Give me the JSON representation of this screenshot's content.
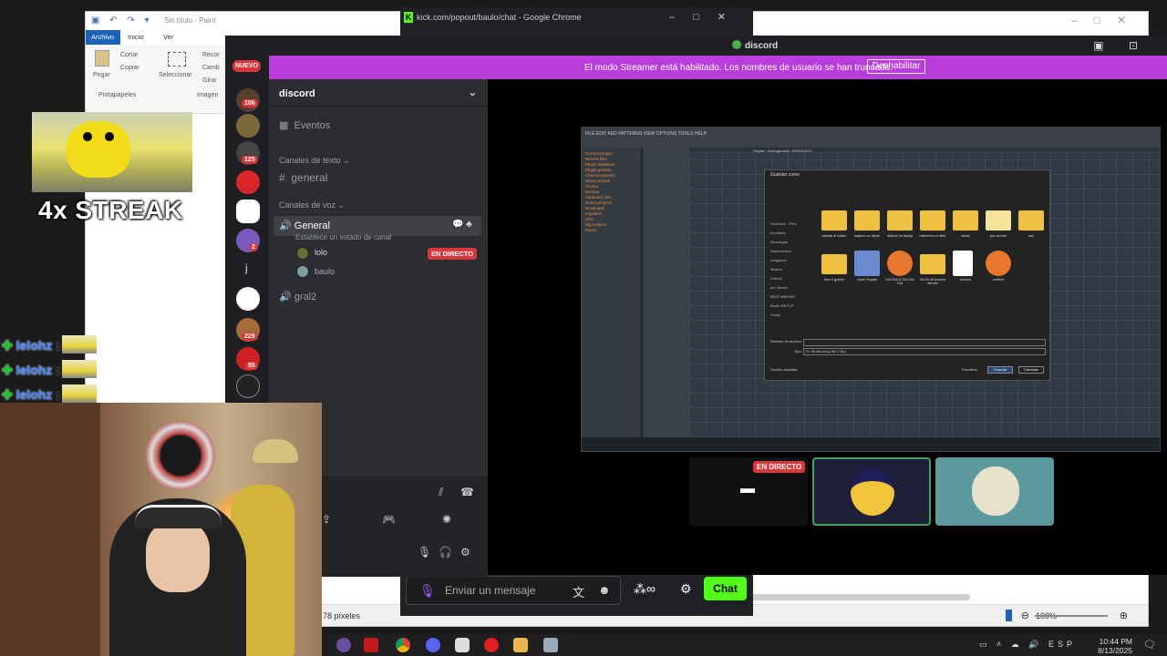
{
  "paint": {
    "title": "Sin título - Paint",
    "menu": {
      "file": "Archivo",
      "home": "Inicio",
      "view": "Ver"
    },
    "ribbon": {
      "paste": "Pegar",
      "cut": "Cortar",
      "copy": "Copiar",
      "select": "Seleccionar",
      "crop": "Recor",
      "resize": "Camb",
      "rotate": "Girar",
      "clipboard_group": "Portapapeles",
      "image_group": "Imagen"
    },
    "status": {
      "size_unit": "78 píxeles",
      "zoom": "100%"
    }
  },
  "chrome": {
    "title": "kick.com/popout/baulo/chat - Google Chrome",
    "url": "kick.com/popout/baulo/chat",
    "message_placeholder": "Enviar un mensaje",
    "chat_button": "Chat"
  },
  "discord": {
    "title": "discord",
    "banner": {
      "text": "El modo Streamer está habilitado. Los nombres de usuario se han truncado.",
      "button": "Deshabilitar"
    },
    "new_badge": "NUEVO",
    "servers": [
      {
        "badge": "106"
      },
      {
        "badge": ""
      },
      {
        "badge": "125"
      },
      {
        "badge": ""
      },
      {
        "badge": ""
      },
      {
        "badge": "2"
      },
      {
        "label": "j"
      },
      {
        "badge": ""
      },
      {
        "badge": "229"
      },
      {
        "badge": "55"
      },
      {
        "badge": ""
      }
    ],
    "server_name": "discord",
    "events": "Eventos",
    "text_category": "Canales de texto",
    "text_channel": "general",
    "voice_category": "Canales de voz",
    "voice_channel": "General",
    "voice_status": "Establece un estado de canal",
    "voice_users": [
      {
        "name": "lolo"
      },
      {
        "name": "baulo"
      }
    ],
    "live_label": "EN DIRECTO",
    "voice_channel_2": "gral2",
    "stream_tile_live": "EN DIRECTO"
  },
  "overlays": {
    "streak": "4x STREAK",
    "feed": [
      {
        "user": "lelohz"
      },
      {
        "user": "lelohz"
      },
      {
        "user": "lelohz"
      }
    ]
  },
  "fl_dialog": {
    "title": "Guardar como",
    "folders": [
      "admita al rodiko",
      "bajamo no llame",
      "fallecio mi family",
      "fallecemo el after",
      "ideas",
      "por vender",
      "wsi",
      "fuiur il gukimi",
      "Clash Royale",
      "DIA DIA & DIA DIA DIA",
      "08-08-48 Acceso directo",
      "musica",
      "untitled"
    ],
    "sidebar": [
      "OneDrive - Pers",
      "Escritorio",
      "Descargas",
      "Documentos",
      "Imágenes",
      "Música",
      "Vídeos",
      "por vender",
      "BEAT MAKING",
      "Beat1.RB.FLP",
      "Packs"
    ],
    "file_name_label": "Nombre de archivo:",
    "type_label": "Tipo:",
    "type_value": "FL Studio song file (*.flp)",
    "hide_folders": "Ocultar carpetas",
    "favorites": "Favoritos",
    "save": "Guardar",
    "cancel": "Cancelar",
    "fl_menu": "FILE EDIT ADD PATTERNS VIEW OPTIONS TOOLS HELP",
    "browser_items": [
      "Current project",
      "Recent files",
      "Plugin database",
      "Plugin presets",
      "Channel presets",
      "Mixer presets",
      "Scores",
      "Backup",
      "Clipboard files",
      "Demo projects",
      "Envelopes",
      "Impulses",
      "Misc",
      "My projects",
      "Packs"
    ],
    "playlist_title": "Playlist - Arrangement › ZENOLOGY"
  },
  "taskbar": {
    "lang": "ESP",
    "time": "10:44 PM",
    "date": "8/13/2025"
  }
}
